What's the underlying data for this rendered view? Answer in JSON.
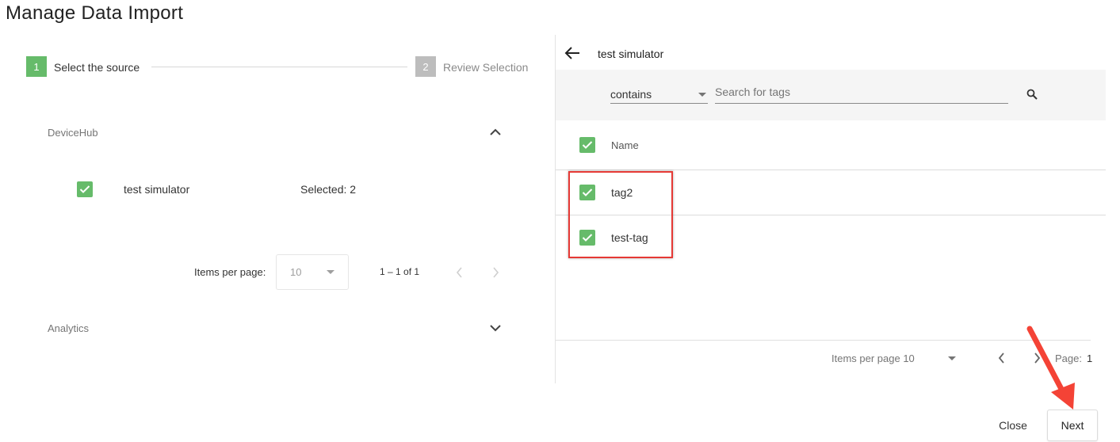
{
  "page": {
    "title": "Manage Data Import"
  },
  "stepper": {
    "steps": [
      {
        "number": "1",
        "label": "Select the source",
        "state": "active"
      },
      {
        "number": "2",
        "label": "Review Selection",
        "state": "inactive"
      }
    ]
  },
  "sources": {
    "devicehub": {
      "label": "DeviceHub",
      "expanded": true,
      "items": [
        {
          "name": "test simulator",
          "checked": true,
          "selected_text": "Selected: 2"
        }
      ],
      "pagination": {
        "items_per_page_label": "Items per page:",
        "items_per_page_value": "10",
        "range_text": "1 – 1 of 1"
      }
    },
    "analytics": {
      "label": "Analytics",
      "expanded": false
    }
  },
  "tag_panel": {
    "back_title": "test simulator",
    "filter": {
      "mode": "contains",
      "placeholder": "Search for tags"
    },
    "header": {
      "name_label": "Name",
      "all_checked": true
    },
    "rows": [
      {
        "name": "tag2",
        "checked": true
      },
      {
        "name": "test-tag",
        "checked": true
      }
    ],
    "highlight_color": "#e53935",
    "pagination": {
      "items_per_page_text": "Items per page 10",
      "page_label": "Page:",
      "page_number": "1"
    }
  },
  "footer": {
    "close_label": "Close",
    "next_label": "Next"
  },
  "colors": {
    "accent_green": "#66bb6a",
    "inactive_gray": "#bdbdbd",
    "annotation_red": "#f44336"
  },
  "icons": {
    "back": "arrow-left-icon",
    "search": "search-icon",
    "collapse": "chevron-up-icon",
    "expand": "chevron-down-icon",
    "prev": "chevron-left-icon",
    "next": "chevron-right-icon",
    "check": "check-icon",
    "dropdown": "caret-down-icon",
    "annotation": "red-arrow"
  }
}
